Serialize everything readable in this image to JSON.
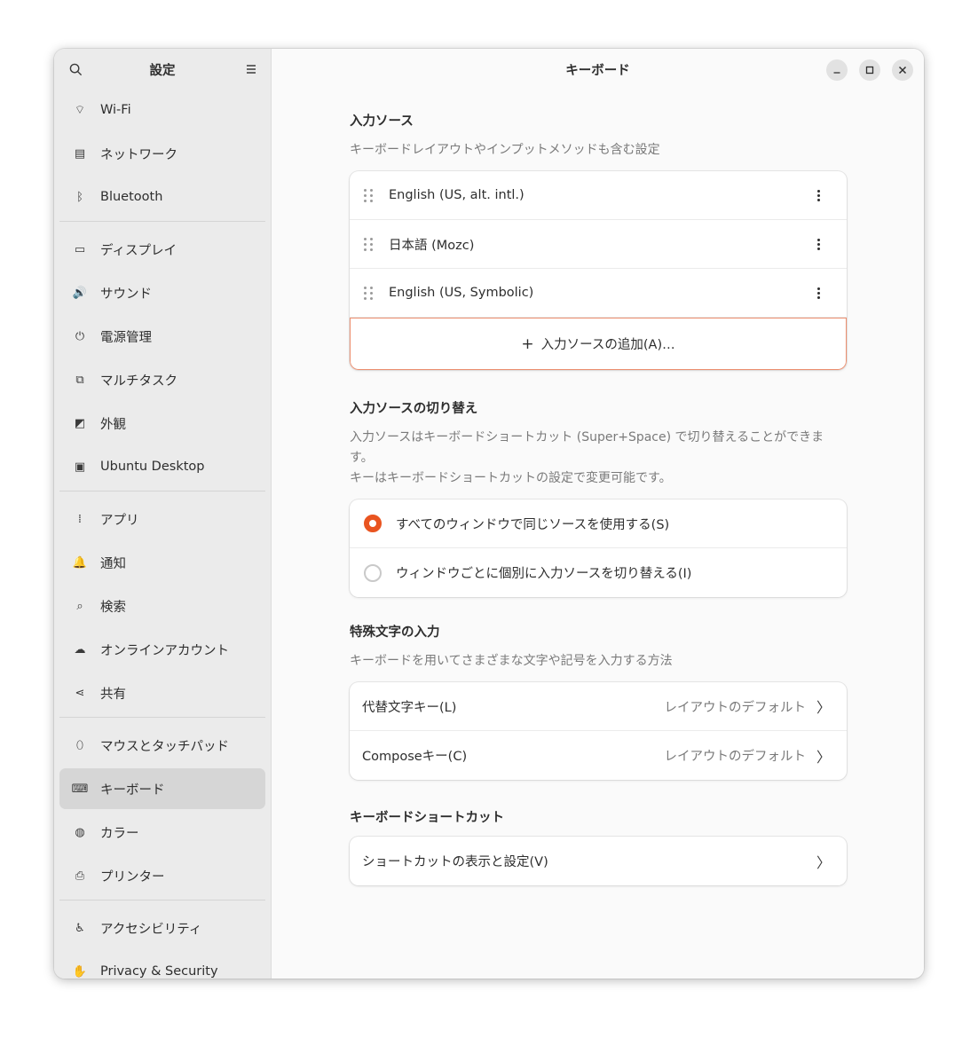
{
  "sidebar": {
    "title": "設定",
    "items": [
      {
        "label": "Wi-Fi",
        "icon": "wifi-icon",
        "glyph": "⌔"
      },
      {
        "label": "ネットワーク",
        "icon": "network-icon",
        "glyph": "▤"
      },
      {
        "label": "Bluetooth",
        "icon": "bluetooth-icon",
        "glyph": "ᛒ"
      },
      {
        "label": "ディスプレイ",
        "icon": "display-icon",
        "glyph": "▭"
      },
      {
        "label": "サウンド",
        "icon": "sound-icon",
        "glyph": "🔊"
      },
      {
        "label": "電源管理",
        "icon": "power-icon",
        "glyph": "⏻"
      },
      {
        "label": "マルチタスク",
        "icon": "multitasking-icon",
        "glyph": "⧉"
      },
      {
        "label": "外観",
        "icon": "appearance-icon",
        "glyph": "◩"
      },
      {
        "label": "Ubuntu Desktop",
        "icon": "ubuntu-desktop-icon",
        "glyph": "▣"
      },
      {
        "label": "アプリ",
        "icon": "apps-icon",
        "glyph": "⁞"
      },
      {
        "label": "通知",
        "icon": "notifications-icon",
        "glyph": "🔔"
      },
      {
        "label": "検索",
        "icon": "search-icon",
        "glyph": "⌕"
      },
      {
        "label": "オンラインアカウント",
        "icon": "cloud-icon",
        "glyph": "☁"
      },
      {
        "label": "共有",
        "icon": "share-icon",
        "glyph": "⋖"
      },
      {
        "label": "マウスとタッチパッド",
        "icon": "mouse-icon",
        "glyph": "⬯"
      },
      {
        "label": "キーボード",
        "icon": "keyboard-icon",
        "glyph": "⌨"
      },
      {
        "label": "カラー",
        "icon": "color-icon",
        "glyph": "◍"
      },
      {
        "label": "プリンター",
        "icon": "printer-icon",
        "glyph": "⎙"
      },
      {
        "label": "アクセシビリティ",
        "icon": "accessibility-icon",
        "glyph": "♿"
      },
      {
        "label": "Privacy & Security",
        "icon": "privacy-hand-icon",
        "glyph": "✋"
      }
    ]
  },
  "main": {
    "title": "キーボード",
    "input_sources": {
      "title": "入力ソース",
      "description": "キーボードレイアウトやインプットメソッドも含む設定",
      "items": [
        "English (US, alt. intl.)",
        "日本語 (Mozc)",
        "English (US, Symbolic)"
      ],
      "add_label": "入力ソースの追加(A)…"
    },
    "switching": {
      "title": "入力ソースの切り替え",
      "description_line1": "入力ソースはキーボードショートカット (Super+Space) で切り替えることができま",
      "description_line2": "す。",
      "description_line3": "キーはキーボードショートカットの設定で変更可能です。",
      "option_same": "すべてのウィンドウで同じソースを使用する(S)",
      "option_each": "ウィンドウごとに個別に入力ソースを切り替える(I)",
      "selected": "same"
    },
    "special_chars": {
      "title": "特殊文字の入力",
      "description": "キーボードを用いてさまざまな文字や記号を入力する方法",
      "alt_key_label": "代替文字キー(L)",
      "alt_key_value": "レイアウトのデフォルト",
      "compose_label": "Composeキー(C)",
      "compose_value": "レイアウトのデフォルト"
    },
    "shortcuts": {
      "title": "キーボードショートカット",
      "view_label": "ショートカットの表示と設定(V)"
    }
  },
  "colors": {
    "accent": "#e95420",
    "focus_border": "#ec8e6e"
  }
}
